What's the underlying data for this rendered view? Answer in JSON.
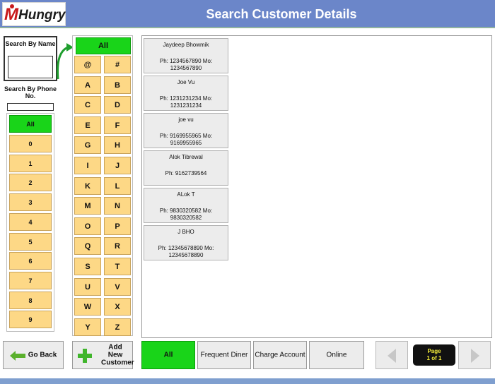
{
  "header": {
    "logo_m": "M",
    "logo_rest": "Hungry",
    "title": "Search Customer Details"
  },
  "search": {
    "by_name_label": "Search By Name",
    "name_value": "",
    "by_phone_label": "Search By Phone No.",
    "phone_value": ""
  },
  "numbers": {
    "all": "All",
    "digits": [
      "0",
      "1",
      "2",
      "3",
      "4",
      "5",
      "6",
      "7",
      "8",
      "9"
    ]
  },
  "letters": {
    "all": "All",
    "keys": [
      "@",
      "#",
      "A",
      "B",
      "C",
      "D",
      "E",
      "F",
      "G",
      "H",
      "I",
      "J",
      "K",
      "L",
      "M",
      "N",
      "O",
      "P",
      "Q",
      "R",
      "S",
      "T",
      "U",
      "V",
      "W",
      "X",
      "Y",
      "Z"
    ]
  },
  "customers": [
    {
      "name": "Jaydeep Bhowmik",
      "phone": "Ph: 1234567890 Mo: 1234567890"
    },
    {
      "name": "Joe Vu",
      "phone": "Ph: 1231231234 Mo: 1231231234"
    },
    {
      "name": "joe vu",
      "phone": "Ph: 9169955965 Mo: 9169955965"
    },
    {
      "name": "Alok Tibrewal",
      "phone": "Ph: 9162739564"
    },
    {
      "name": "ALok T",
      "phone": "Ph: 9830320582 Mo: 9830320582"
    },
    {
      "name": "J BHO",
      "phone": "Ph: 12345678890 Mo: 12345678890"
    }
  ],
  "bottom": {
    "go_back": "Go Back",
    "add_new": "Add New Customer",
    "filters": [
      "All",
      "Frequent Diner",
      "Charge Account",
      "Online"
    ],
    "page_label": "Page",
    "page_value": "1 of 1"
  },
  "colors": {
    "header": "#6b86c9",
    "active_green": "#19d419",
    "key_yellow": "#fdd886",
    "page_text": "#f7ee3a"
  },
  "icons": {
    "go_back": "green-left-arrow-icon",
    "add_new": "green-plus-icon",
    "prev": "chevron-left-icon",
    "next": "chevron-right-icon",
    "curve": "curved-arrow-icon"
  }
}
